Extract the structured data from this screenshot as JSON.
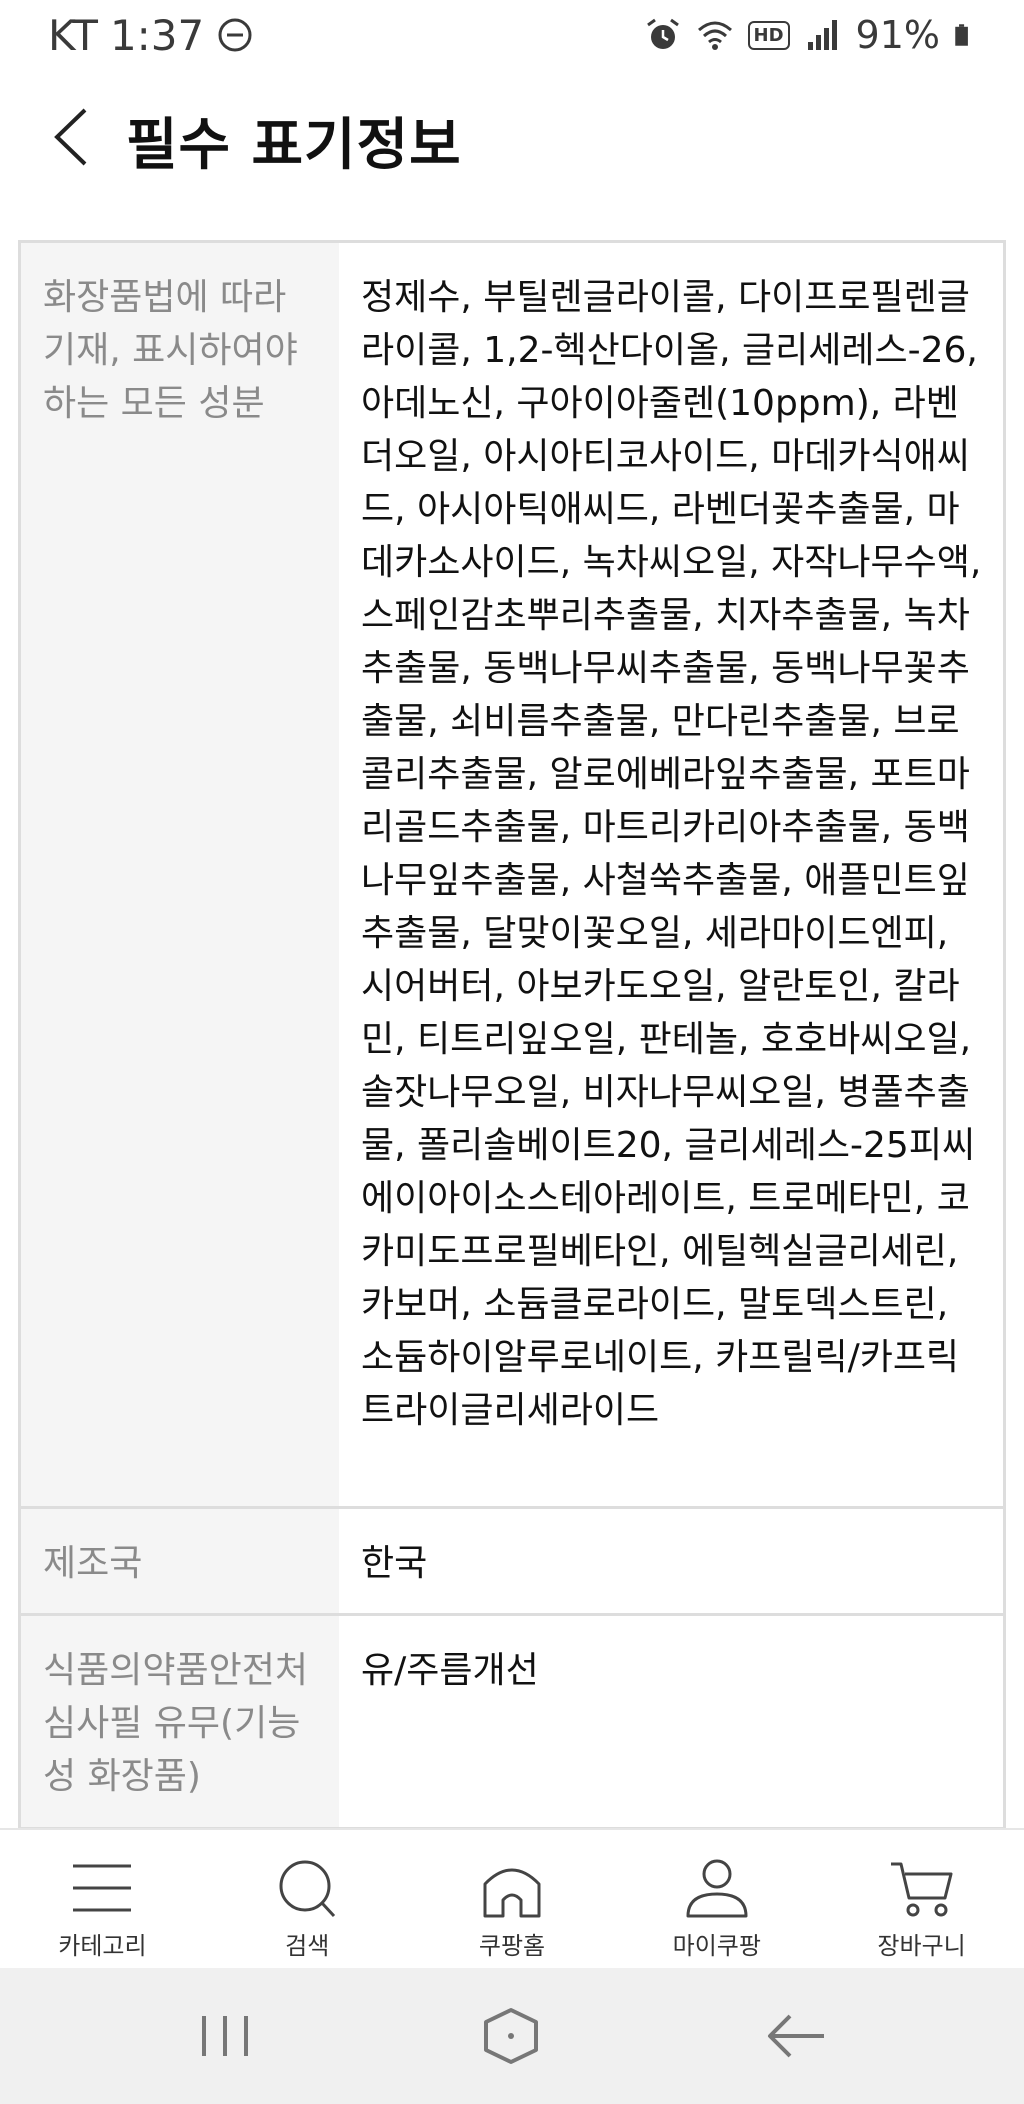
{
  "status_bar": {
    "carrier": "KT",
    "time": "1:37",
    "hd_label": "HD",
    "battery_percent": "91%"
  },
  "header": {
    "title": "필수 표기정보"
  },
  "table": {
    "rows": [
      {
        "label": "화장품법에 따라 기재, 표시하여야 하는 모든 성분",
        "value": "정제수, 부틸렌글라이콜, 다이프로필렌글라이콜, 1,2-헥산다이올, 글리세레스-26, 아데노신, 구아이아줄렌(10ppm), 라벤더오일, 아시아티코사이드, 마데카식애씨드, 아시아틱애씨드, 라벤더꽃추출물, 마데카소사이드, 녹차씨오일, 자작나무수액, 스페인감초뿌리추출물, 치자추출물, 녹차추출물, 동백나무씨추출물, 동백나무꽃추출물, 쇠비름추출물, 만다린추출물, 브로콜리추출물, 알로에베라잎추출물, 포트마리골드추출물, 마트리카리아추출물, 동백나무잎추출물, 사철쑥추출물, 애플민트잎추출물, 달맞이꽃오일, 세라마이드엔피, 시어버터, 아보카도오일, 알란토인, 칼라민, 티트리잎오일, 판테놀, 호호바씨오일, 솔잣나무오일, 비자나무씨오일, 병풀추출물, 폴리솔베이트20, 글리세레스-25피씨에이아이소스테아레이트, 트로메타민, 코카미도프로필베타인, 에틸헥실글리세린, 카보머, 소듐클로라이드, 말토덱스트린, 소듐하이알루로네이트, 카프릴릭/카프릭트라이글리세라이드"
      },
      {
        "label": "제조국",
        "value": "한국"
      },
      {
        "label": "식품의약품안전처 심사필 유무(기능성 화장품)",
        "value": "유/주름개선"
      }
    ]
  },
  "bottom_nav": {
    "items": [
      {
        "label": "카테고리",
        "icon": "menu-icon"
      },
      {
        "label": "검색",
        "icon": "search-icon"
      },
      {
        "label": "쿠팡홈",
        "icon": "home-icon"
      },
      {
        "label": "마이쿠팡",
        "icon": "user-icon"
      },
      {
        "label": "장바구니",
        "icon": "cart-icon"
      }
    ]
  },
  "colors": {
    "label_background": "#f5f5f5",
    "label_text": "#8a8a8a",
    "border": "#dddddd",
    "system_nav_background": "#f0f0f0"
  }
}
